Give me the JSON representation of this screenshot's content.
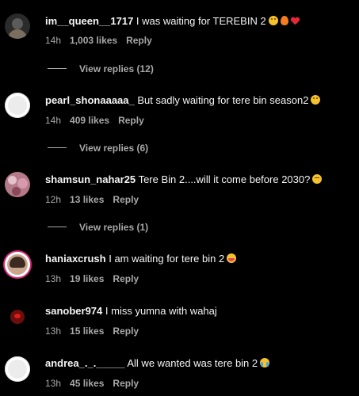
{
  "comments": [
    {
      "username": "im__queen__1717",
      "text": "I was waiting for TEREBIN 2",
      "emojis": [
        "flushed-face",
        "fire",
        "red-heart"
      ],
      "time": "14h",
      "likes": "1,003 likes",
      "reply": "Reply",
      "view_replies": "View replies (12)"
    },
    {
      "username": "pearl_shonaaaaa_",
      "text": "But sadly waiting for tere bin season2",
      "emojis": [
        "flushed-face"
      ],
      "time": "14h",
      "likes": "409 likes",
      "reply": "Reply",
      "view_replies": "View replies (6)"
    },
    {
      "username": "shamsun_nahar25",
      "text": "Tere Bin 2....will it come before 2030?",
      "emojis": [
        "relieved-face"
      ],
      "time": "12h",
      "likes": "13 likes",
      "reply": "Reply",
      "view_replies": "View replies (1)"
    },
    {
      "username": "haniaxcrush",
      "text": "I am waiting for tere bin 2",
      "emojis": [
        "grinning-squinting-face"
      ],
      "time": "13h",
      "likes": "19 likes",
      "reply": "Reply"
    },
    {
      "username": "sanober974",
      "text": "I miss yumna with wahaj",
      "emojis": [],
      "time": "13h",
      "likes": "15 likes",
      "reply": "Reply"
    },
    {
      "username": "andrea_._._____",
      "text": "All we wanted was tere bin 2",
      "emojis": [
        "crying-face"
      ],
      "time": "13h",
      "likes": "45 likes",
      "reply": "Reply"
    }
  ],
  "colors": {
    "background": "#000000",
    "primary_text": "#f5f5f5",
    "secondary_text": "#a8a8a8"
  }
}
